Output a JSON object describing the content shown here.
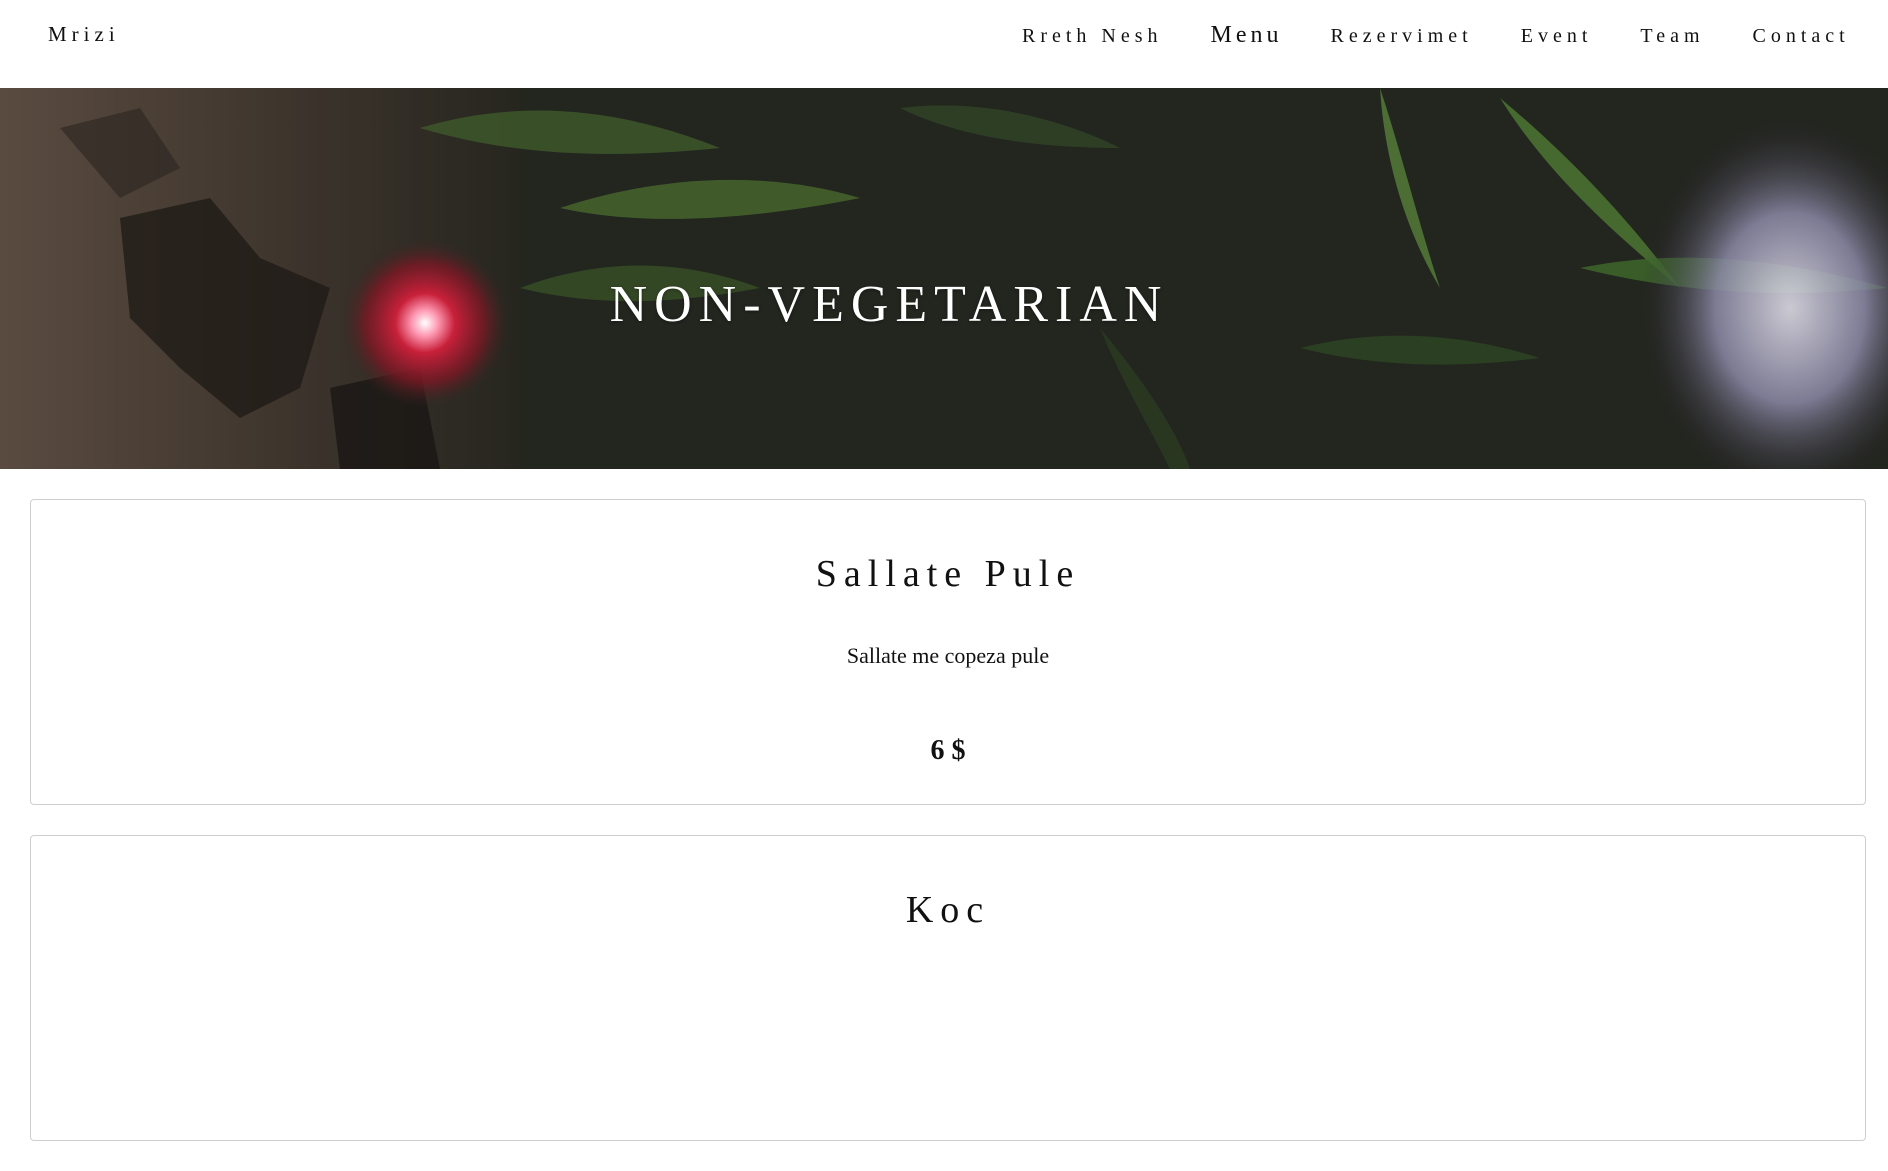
{
  "brand": "Mrizi",
  "nav": {
    "items": [
      {
        "label": "Rreth Nesh"
      },
      {
        "label": "Menu"
      },
      {
        "label": "Rezervimet"
      },
      {
        "label": "Event"
      },
      {
        "label": "Team"
      },
      {
        "label": "Contact"
      }
    ],
    "active": "Menu"
  },
  "hero": {
    "title": "NON-VEGETARIAN"
  },
  "menu_items": [
    {
      "name": "Sallate Pule",
      "description": "Sallate me copeza pule",
      "price": "6 $"
    },
    {
      "name": "Koc",
      "description": "",
      "price": ""
    }
  ]
}
